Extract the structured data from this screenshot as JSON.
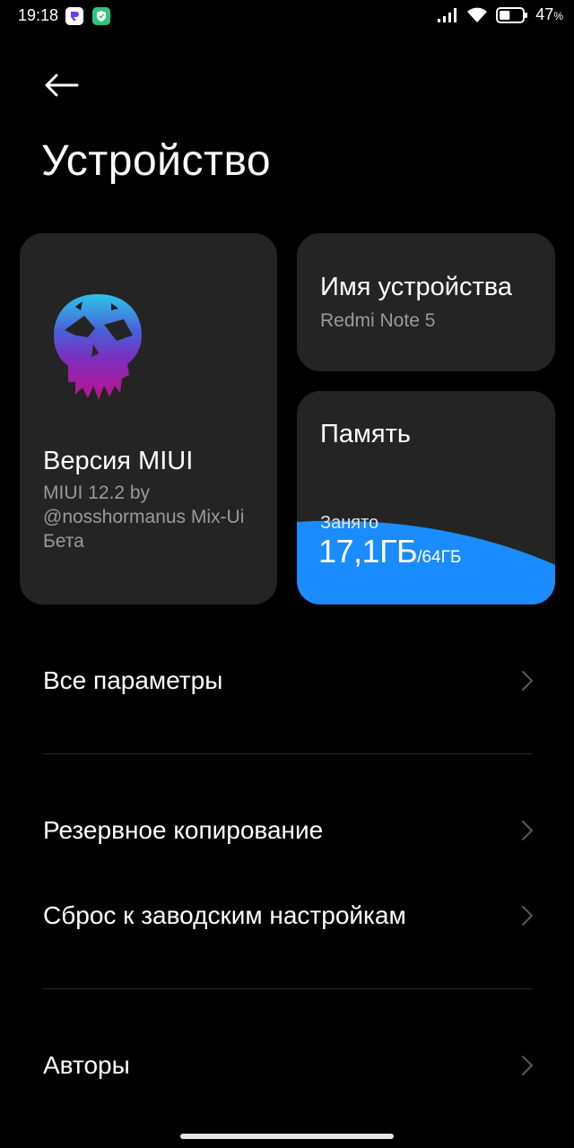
{
  "status_bar": {
    "time": "19:18",
    "battery_percent": "47",
    "battery_percent_sign": "%",
    "battery_level": 0.47,
    "icons": [
      "app-notification-icon",
      "shield-app-icon",
      "cellular-signal-icon",
      "wifi-icon",
      "battery-icon"
    ]
  },
  "header": {
    "back_icon": "back-arrow-icon",
    "title": "Устройство"
  },
  "cards": {
    "miui": {
      "image": "skull-logo",
      "title": "Версия MIUI",
      "subtitle": "MIUI 12.2 by @nosshormanus Mix-Ui Бета"
    },
    "device_name": {
      "title": "Имя устройства",
      "value": "Redmi Note 5"
    },
    "memory": {
      "title": "Память",
      "used_label": "Занято",
      "used_value": "17,1ГБ",
      "total_value": "/64ГБ",
      "used_fraction": 0.267,
      "fill_color": "#1a8cff"
    }
  },
  "menu": {
    "all_settings": "Все параметры",
    "backup": "Резервное копирование",
    "factory_reset": "Сброс к заводским настройкам",
    "authors": "Авторы"
  },
  "colors": {
    "background": "#000000",
    "card": "#242424",
    "accent": "#1a8cff",
    "secondary_text": "#9a9a9a"
  }
}
